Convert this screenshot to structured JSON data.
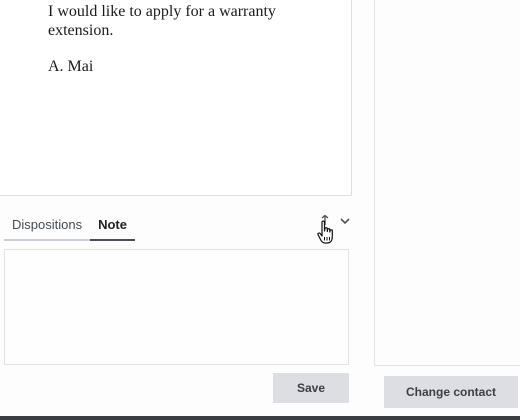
{
  "email": {
    "lines": [
      "I would like to apply for a warranty extension.",
      "A. Mai"
    ]
  },
  "tabs": [
    {
      "label": "Dispositions",
      "active": false
    },
    {
      "label": "Note",
      "active": true
    }
  ],
  "icons": {
    "expand": "expand-icon",
    "chevron": "chevron-down-icon",
    "cursor": "hand-pointer-icon"
  },
  "note": {
    "value": "",
    "placeholder": ""
  },
  "buttons": {
    "save_label": "Save",
    "change_contact_label": "Change contact"
  },
  "colors": {
    "button_bg": "#dcdee3",
    "active_tab_underline": "#4a4f57"
  }
}
